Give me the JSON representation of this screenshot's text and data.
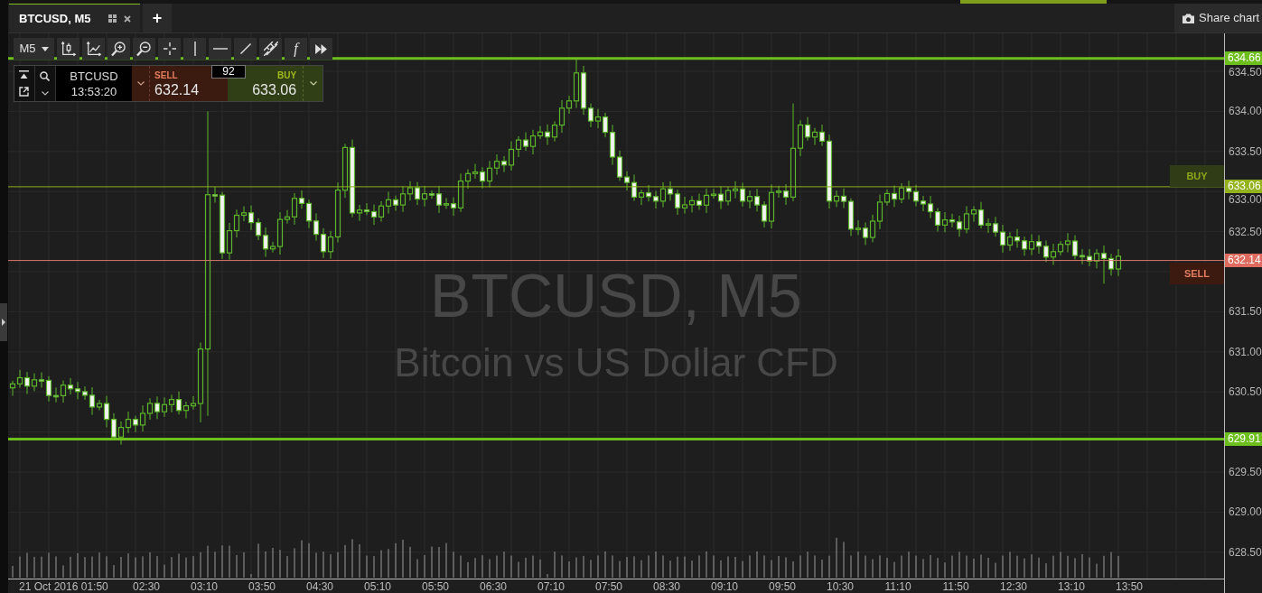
{
  "tabs": [
    {
      "label": "BTCUSD, M5",
      "selected": true
    }
  ],
  "new_tab": "+",
  "share_button": {
    "label": "Share chart"
  },
  "toolbar": {
    "timeframe": "M5",
    "tools": [
      {
        "kind": "candles"
      },
      {
        "kind": "linechart"
      },
      {
        "kind": "zoomin"
      },
      {
        "kind": "zoomout"
      },
      {
        "kind": "crosshair"
      },
      {
        "kind": "vline"
      },
      {
        "kind": "hline"
      },
      {
        "kind": "trendline"
      },
      {
        "kind": "channel"
      },
      {
        "kind": "function",
        "label": "f"
      },
      {
        "kind": "forward"
      }
    ]
  },
  "trade_panel": {
    "symbol": "BTCUSD",
    "time": "13:53:20",
    "sell": {
      "label": "SELL",
      "price": "632.14"
    },
    "spread": "92",
    "buy": {
      "label": "BUY",
      "price": "633.06"
    }
  },
  "chart": {
    "title": "BTCUSD, M5",
    "subtitle": "Bitcoin vs US Dollar CFD",
    "price_levels": [
      {
        "kind": "high",
        "price": "634.66"
      },
      {
        "kind": "buy",
        "price": "633.06",
        "label": "BUY"
      },
      {
        "kind": "sell",
        "price": "632.14",
        "label": "SELL"
      },
      {
        "kind": "low",
        "price": "629.91"
      }
    ],
    "price_axis": [
      "634.50",
      "634.00",
      "633.50",
      "633.00",
      "632.50",
      "631.50",
      "631.00",
      "630.50",
      "629.50",
      "629.00",
      "628.50"
    ],
    "time_axis": [
      "21 Oct 2016 01:50",
      "02:30",
      "03:10",
      "03:50",
      "04:30",
      "05:10",
      "05:50",
      "06:30",
      "07:10",
      "07:50",
      "08:30",
      "09:10",
      "09:50",
      "10:30",
      "11:10",
      "11:50",
      "12:30",
      "13:10",
      "13:50"
    ]
  }
}
